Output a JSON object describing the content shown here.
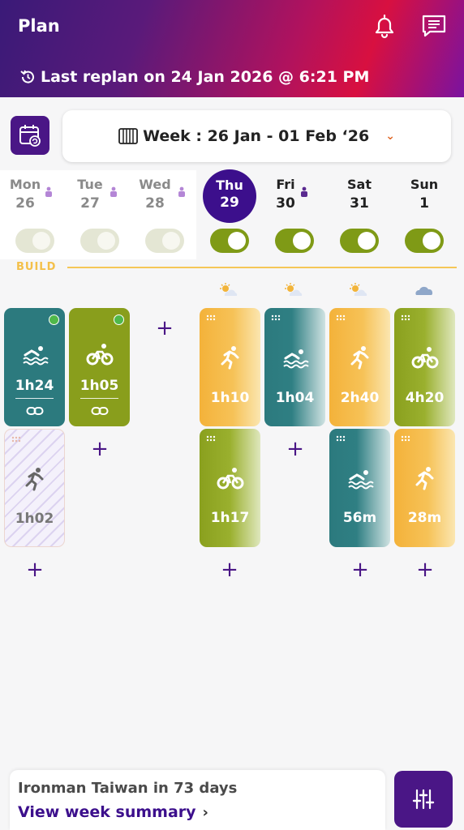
{
  "header": {
    "title": "Plan",
    "last_replan": "Last replan on 24 Jan 2026 @ 6:21 PM"
  },
  "week": {
    "label": "Week : 26 Jan - 01 Feb ‘26"
  },
  "days": [
    {
      "name": "Mon",
      "num": "26"
    },
    {
      "name": "Tue",
      "num": "27"
    },
    {
      "name": "Wed",
      "num": "28"
    },
    {
      "name": "Thu",
      "num": "29"
    },
    {
      "name": "Fri",
      "num": "30"
    },
    {
      "name": "Sat",
      "num": "31"
    },
    {
      "name": "Sun",
      "num": "1"
    }
  ],
  "phase_label": "BUILD",
  "workouts": [
    {
      "day": "Mon",
      "sport": "swim",
      "duration": "1h24",
      "completed": true
    },
    {
      "day": "Tue",
      "sport": "bike",
      "duration": "1h05",
      "completed": true
    },
    {
      "day": "Thu",
      "sport": "run",
      "duration": "1h10"
    },
    {
      "day": "Fri",
      "sport": "swim",
      "duration": "1h04"
    },
    {
      "day": "Sat",
      "sport": "run",
      "duration": "2h40"
    },
    {
      "day": "Sun",
      "sport": "bike",
      "duration": "4h20"
    },
    {
      "day": "Mon",
      "sport": "run",
      "duration": "1h02",
      "missed": true
    },
    {
      "day": "Thu",
      "sport": "bike",
      "duration": "1h17"
    },
    {
      "day": "Sat",
      "sport": "swim",
      "duration": "56m"
    },
    {
      "day": "Sun",
      "sport": "run",
      "duration": "28m"
    }
  ],
  "footer": {
    "race_countdown": "Ironman Taiwan in 73 days",
    "summary_link": "View week summary",
    "summary_arrow": "›"
  },
  "colors": {
    "primary": "#4a1686",
    "swim": "#2c7a7e",
    "bike": "#899e1c",
    "run": "#f4b23a",
    "build": "#f5c757"
  }
}
